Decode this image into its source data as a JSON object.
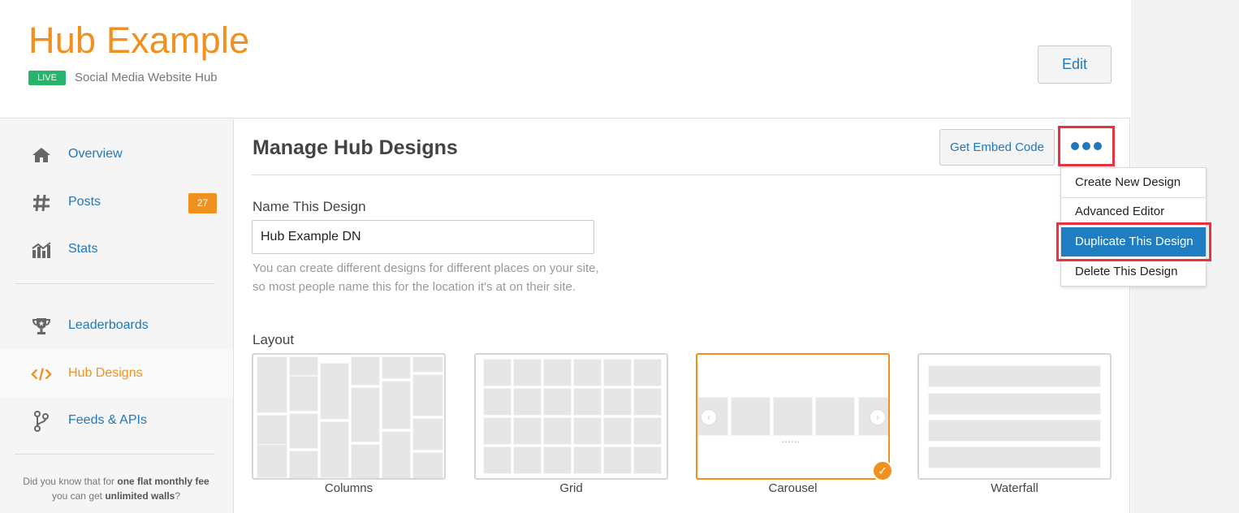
{
  "header": {
    "title": "Hub Example",
    "status_badge": "LIVE",
    "subtitle": "Social Media Website Hub",
    "edit_label": "Edit"
  },
  "sidebar": {
    "items": [
      {
        "label": "Overview",
        "icon": "home-icon"
      },
      {
        "label": "Posts",
        "icon": "hashtag-icon",
        "badge": "27"
      },
      {
        "label": "Stats",
        "icon": "stats-chart-icon"
      },
      {
        "label": "Leaderboards",
        "icon": "trophy-icon"
      },
      {
        "label": "Hub Designs",
        "icon": "code-icon",
        "active": true
      },
      {
        "label": "Feeds & APIs",
        "icon": "branch-icon"
      }
    ],
    "tip": {
      "part1": "Did you know that for ",
      "bold1": "one flat monthly fee",
      "part2": " you can get ",
      "bold2": "unlimited walls",
      "part3": "?"
    }
  },
  "content": {
    "title": "Manage Hub Designs",
    "embed_label": "Get Embed Code",
    "more_icon": "more-dots-icon",
    "dropdown": [
      "Create New Design",
      "Advanced Editor",
      "Duplicate This Design",
      "Delete This Design"
    ],
    "name_label": "Name This Design",
    "name_value": "Hub Example DN",
    "help_line1": "You can create different designs for different places on your site,",
    "help_line2": "so most people name this for the location it's at on their site.",
    "layout_label": "Layout",
    "layouts": [
      "Columns",
      "Grid",
      "Carousel",
      "Waterfall"
    ],
    "selected_layout": "Carousel"
  },
  "colors": {
    "accent_orange": "#f0901e",
    "link_blue": "#2277b9",
    "live_green": "#29b36a",
    "highlight_red": "#e8323f",
    "menu_active_blue": "#1f7ec1"
  }
}
